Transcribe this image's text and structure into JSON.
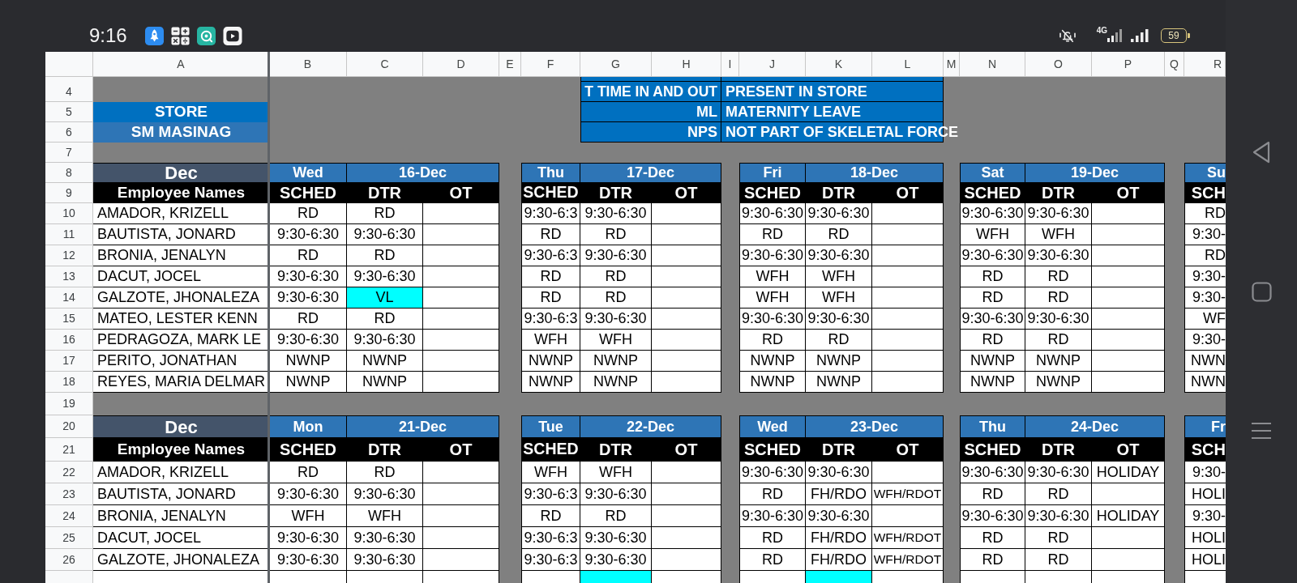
{
  "status_bar": {
    "time": "9:16",
    "network": "4G",
    "battery": "59"
  },
  "sheet": {
    "columns": [
      "A",
      "B",
      "C",
      "D",
      "E",
      "F",
      "G",
      "H",
      "I",
      "J",
      "K",
      "L",
      "M",
      "N",
      "O",
      "P",
      "Q",
      "R"
    ],
    "rows": [
      {
        "kind": "edge"
      },
      {
        "kind": "info",
        "number": "4",
        "legend": {
          "code": "T TIME IN AND OUT",
          "meaning": "PRESENT IN STORE"
        }
      },
      {
        "kind": "info",
        "number": "5",
        "store": {
          "kind": "label",
          "text": "STORE"
        },
        "legend": {
          "code": "ML",
          "meaning": "MATERNITY LEAVE"
        }
      },
      {
        "kind": "info",
        "number": "6",
        "store": {
          "kind": "value",
          "text": "SM MASINAG"
        },
        "legend": {
          "code": "NPS",
          "meaning": "NOT PART OF SKELETAL FORCE"
        }
      },
      {
        "kind": "info",
        "number": "7"
      },
      {
        "kind": "days",
        "number": "8",
        "month": "Dec",
        "days": [
          {
            "weekday": "Wed",
            "date": "16-Dec"
          },
          {
            "weekday": "Thu",
            "date": "17-Dec"
          },
          {
            "weekday": "Fri",
            "date": "18-Dec"
          },
          {
            "weekday": "Sat",
            "date": "19-Dec"
          },
          {
            "weekday": "Su"
          }
        ]
      },
      {
        "kind": "fields",
        "number": "9",
        "label": "Employee Names",
        "days": [
          [
            "SCHED",
            "DTR",
            "OT"
          ],
          [
            "SCHED",
            "DTR",
            "OT"
          ],
          [
            "SCHED",
            "DTR",
            "OT"
          ],
          [
            "SCHED",
            "DTR",
            "OT"
          ],
          [
            "SCH"
          ]
        ]
      },
      {
        "kind": "employee",
        "number": "10",
        "name": "AMADOR, KRIZELL",
        "days": [
          {
            "sched": "RD",
            "dtr": "RD"
          },
          {
            "sched": "9:30-6:3",
            "dtr": "9:30-6:30"
          },
          {
            "sched": "9:30-6:30",
            "dtr": "9:30-6:30"
          },
          {
            "sched": "9:30-6:30",
            "dtr": "9:30-6:30"
          },
          {
            "sched": "RD"
          }
        ]
      },
      {
        "kind": "employee",
        "number": "11",
        "name": "BAUTISTA, JONARD",
        "days": [
          {
            "sched": "9:30-6:30",
            "dtr": "9:30-6:30"
          },
          {
            "sched": "RD",
            "dtr": "RD"
          },
          {
            "sched": "RD",
            "dtr": "RD"
          },
          {
            "sched": "WFH",
            "dtr": "WFH"
          },
          {
            "sched": "9:30-"
          }
        ]
      },
      {
        "kind": "employee",
        "number": "12",
        "name": "BRONIA, JENALYN",
        "days": [
          {
            "sched": "RD",
            "dtr": "RD"
          },
          {
            "sched": "9:30-6:3",
            "dtr": "9:30-6:30"
          },
          {
            "sched": "9:30-6:30",
            "dtr": "9:30-6:30"
          },
          {
            "sched": "9:30-6:30",
            "dtr": "9:30-6:30"
          },
          {
            "sched": "RD"
          }
        ]
      },
      {
        "kind": "employee",
        "number": "13",
        "name": "DACUT, JOCEL",
        "days": [
          {
            "sched": "9:30-6:30",
            "dtr": "9:30-6:30"
          },
          {
            "sched": "RD",
            "dtr": "RD"
          },
          {
            "sched": "WFH",
            "dtr": "WFH"
          },
          {
            "sched": "RD",
            "dtr": "RD"
          },
          {
            "sched": "9:30-"
          }
        ]
      },
      {
        "kind": "employee",
        "number": "14",
        "name": "GALZOTE, JHONALEZA",
        "days": [
          {
            "sched": "9:30-6:30",
            "dtr": {
              "text": "VL",
              "color": "#00ffff"
            }
          },
          {
            "sched": "RD",
            "dtr": "RD"
          },
          {
            "sched": "WFH",
            "dtr": "WFH"
          },
          {
            "sched": "RD",
            "dtr": "RD"
          },
          {
            "sched": "9:30-"
          }
        ]
      },
      {
        "kind": "employee",
        "number": "15",
        "name": "MATEO, LESTER KENN",
        "days": [
          {
            "sched": "RD",
            "dtr": "RD"
          },
          {
            "sched": "9:30-6:3",
            "dtr": "9:30-6:30"
          },
          {
            "sched": "9:30-6:30",
            "dtr": "9:30-6:30"
          },
          {
            "sched": "9:30-6:30",
            "dtr": "9:30-6:30"
          },
          {
            "sched": "WF"
          }
        ]
      },
      {
        "kind": "employee",
        "number": "16",
        "name": "PEDRAGOZA, MARK LE",
        "days": [
          {
            "sched": "9:30-6:30",
            "dtr": "9:30-6:30"
          },
          {
            "sched": "WFH",
            "dtr": "WFH"
          },
          {
            "sched": "RD",
            "dtr": "RD"
          },
          {
            "sched": "RD",
            "dtr": "RD"
          },
          {
            "sched": "9:30-"
          }
        ]
      },
      {
        "kind": "employee",
        "number": "17",
        "name": "PERITO, JONATHAN",
        "days": [
          {
            "sched": "NWNP",
            "dtr": "NWNP"
          },
          {
            "sched": "NWNP",
            "dtr": "NWNP"
          },
          {
            "sched": "NWNP",
            "dtr": "NWNP"
          },
          {
            "sched": "NWNP",
            "dtr": "NWNP"
          },
          {
            "sched": "NWN"
          }
        ]
      },
      {
        "kind": "employee",
        "number": "18",
        "name": "REYES, MARIA DELMAR",
        "days": [
          {
            "sched": "NWNP",
            "dtr": "NWNP"
          },
          {
            "sched": "NWNP",
            "dtr": "NWNP"
          },
          {
            "sched": "NWNP",
            "dtr": "NWNP"
          },
          {
            "sched": "NWNP",
            "dtr": "NWNP"
          },
          {
            "sched": "NWN"
          }
        ]
      },
      {
        "kind": "info",
        "number": "19"
      },
      {
        "kind": "days",
        "number": "20",
        "month": "Dec",
        "days": [
          {
            "weekday": "Mon",
            "date": "21-Dec"
          },
          {
            "weekday": "Tue",
            "date": "22-Dec"
          },
          {
            "weekday": "Wed",
            "date": "23-Dec"
          },
          {
            "weekday": "Thu",
            "date": "24-Dec"
          },
          {
            "weekday": "Fr"
          }
        ]
      },
      {
        "kind": "fields",
        "number": "21",
        "label": "Employee Names",
        "days": [
          [
            "SCHED",
            "DTR",
            "OT"
          ],
          [
            "SCHED",
            "DTR",
            "OT"
          ],
          [
            "SCHED",
            "DTR",
            "OT"
          ],
          [
            "SCHED",
            "DTR",
            "OT"
          ],
          [
            "SCH"
          ]
        ]
      },
      {
        "kind": "employee",
        "number": "22",
        "name": "AMADOR, KRIZELL",
        "days": [
          {
            "sched": "RD",
            "dtr": "RD"
          },
          {
            "sched": "WFH",
            "dtr": "WFH"
          },
          {
            "sched": "9:30-6:30",
            "dtr": "9:30-6:30"
          },
          {
            "sched": "9:30-6:30",
            "dtr": "9:30-6:30",
            "ot": "HOLIDAY"
          },
          {
            "sched": "9:30-"
          }
        ]
      },
      {
        "kind": "employee",
        "number": "23",
        "name": "BAUTISTA, JONARD",
        "days": [
          {
            "sched": "9:30-6:30",
            "dtr": "9:30-6:30"
          },
          {
            "sched": "9:30-6:3",
            "dtr": "9:30-6:30"
          },
          {
            "sched": "RD",
            "dtr": "FH/RDO",
            "ot": "WFH/RDOT"
          },
          {
            "sched": "RD",
            "dtr": "RD"
          },
          {
            "sched": "HOLI"
          }
        ]
      },
      {
        "kind": "employee",
        "number": "24",
        "name": "BRONIA, JENALYN",
        "days": [
          {
            "sched": "WFH",
            "dtr": "WFH"
          },
          {
            "sched": "RD",
            "dtr": "RD"
          },
          {
            "sched": "9:30-6:30",
            "dtr": "9:30-6:30"
          },
          {
            "sched": "9:30-6:30",
            "dtr": "9:30-6:30",
            "ot": "HOLIDAY"
          },
          {
            "sched": "9:30-"
          }
        ]
      },
      {
        "kind": "employee",
        "number": "25",
        "name": "DACUT, JOCEL",
        "days": [
          {
            "sched": "9:30-6:30",
            "dtr": "9:30-6:30"
          },
          {
            "sched": "9:30-6:3",
            "dtr": "9:30-6:30"
          },
          {
            "sched": "RD",
            "dtr": "FH/RDO",
            "ot": "WFH/RDOT"
          },
          {
            "sched": "RD",
            "dtr": "RD"
          },
          {
            "sched": "HOLI"
          }
        ]
      },
      {
        "kind": "employee",
        "number": "26",
        "name": "GALZOTE, JHONALEZA",
        "days": [
          {
            "sched": "9:30-6:30",
            "dtr": "9:30-6:30"
          },
          {
            "sched": "9:30-6:3",
            "dtr": "9:30-6:30"
          },
          {
            "sched": "RD",
            "dtr": "FH/RDO",
            "ot": "WFH/RDOT"
          },
          {
            "sched": "RD",
            "dtr": "RD"
          },
          {
            "sched": "HOLI"
          }
        ]
      },
      {
        "kind": "cut",
        "days": [
          {
            "dtr": {
              "color": "#ffffff"
            }
          },
          {
            "dtr": {
              "color": "#00ffff"
            }
          },
          {
            "dtr": {
              "color": "#00ffff"
            }
          },
          {
            "dtr": {
              "color": "#ffffff"
            }
          }
        ]
      }
    ]
  }
}
